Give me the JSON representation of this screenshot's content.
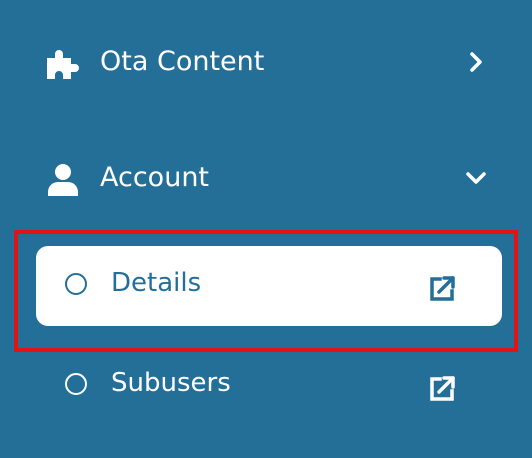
{
  "colors": {
    "background": "#236f98",
    "active_bg": "#ffffff",
    "highlight": "#e11313",
    "text": "#ffffff"
  },
  "nav": {
    "ota_content": {
      "label": "Ota Content",
      "icon": "puzzle-icon",
      "chevron": "chevron-right-icon"
    },
    "account": {
      "label": "Account",
      "icon": "user-icon",
      "chevron": "chevron-down-icon"
    }
  },
  "account_menu": [
    {
      "label": "Details",
      "active": true,
      "icon": "external-link-icon"
    },
    {
      "label": "Subusers",
      "active": false,
      "icon": "external-link-icon"
    }
  ]
}
